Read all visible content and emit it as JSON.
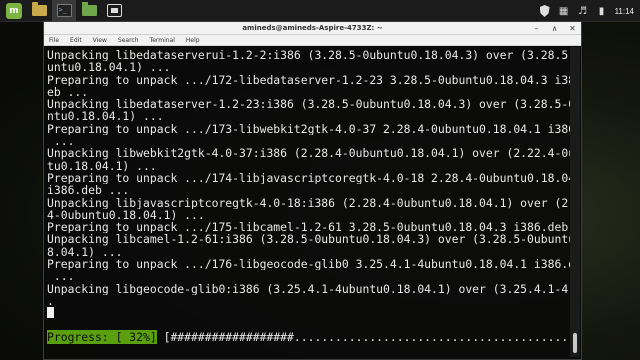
{
  "taskbar": {
    "launchers": [
      {
        "name": "mint-menu",
        "glyph": "m"
      },
      {
        "name": "files-folder",
        "glyph": ""
      },
      {
        "name": "terminal",
        "glyph": ">_"
      },
      {
        "name": "green-folder",
        "glyph": ""
      },
      {
        "name": "file-manager",
        "glyph": ""
      }
    ],
    "clock": "11:14"
  },
  "window": {
    "title": "amineds@amineds-Aspire-4733Z: ~",
    "menu": [
      "File",
      "Edit",
      "View",
      "Search",
      "Terminal",
      "Help"
    ]
  },
  "terminal": {
    "lines": [
      "Unpacking libedataserverui-1.2-2:i386 (3.28.5-0ubuntu0.18.04.3) over (3.28.5-0ub",
      "untu0.18.04.1) ...",
      "Preparing to unpack .../172-libedataserver-1.2-23_3.28.5-0ubuntu0.18.04.3_i386.d",
      "eb ...",
      "Unpacking libedataserver-1.2-23:i386 (3.28.5-0ubuntu0.18.04.3) over (3.28.5-0ubu",
      "ntu0.18.04.1) ...",
      "Preparing to unpack .../173-libwebkit2gtk-4.0-37_2.28.4-0ubuntu0.18.04.1_i386.deb",
      " ...",
      "Unpacking libwebkit2gtk-4.0-37:i386 (2.28.4-0ubuntu0.18.04.1) over (2.22.4-0ubun",
      "tu0.18.04.1) ...",
      "Preparing to unpack .../174-libjavascriptcoregtk-4.0-18_2.28.4-0ubuntu0.18.04.1_",
      "i386.deb ...",
      "Unpacking libjavascriptcoregtk-4.0-18:i386 (2.28.4-0ubuntu0.18.04.1) over (2.22.",
      "4-0ubuntu0.18.04.1) ...",
      "Preparing to unpack .../175-libcamel-1.2-61_3.28.5-0ubuntu0.18.04.3_i386.deb ...",
      "Unpacking libcamel-1.2-61:i386 (3.28.5-0ubuntu0.18.04.3) over (3.28.5-0ubuntu0.1",
      "8.04.1) ...",
      "Preparing to unpack .../176-libgeocode-glib0_3.25.4.1-4ubuntu0.18.04.1_i386.deb",
      " ...",
      "Unpacking libgeocode-glib0:i386 (3.25.4.1-4ubuntu0.18.04.1) over (3.25.4.1-4) ..",
      "."
    ],
    "progress_label": "Progress: [ 32%]",
    "progress_bar": " [##################.........................................]",
    "progress_percent": 32
  },
  "colors": {
    "progress_bg": "#5aa00e",
    "terminal_fg": "#e7e7e7"
  }
}
